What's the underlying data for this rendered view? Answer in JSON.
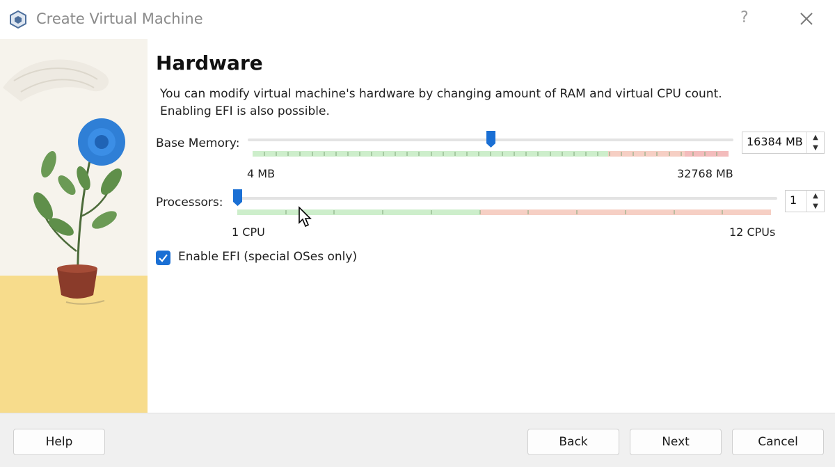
{
  "window": {
    "title": "Create Virtual Machine",
    "help_label": "?"
  },
  "page": {
    "title": "Hardware",
    "description_line1": "You can modify virtual machine's hardware by changing amount of RAM and virtual CPU count.",
    "description_line2": "Enabling EFI is also possible."
  },
  "memory": {
    "label": "Base Memory:",
    "min_label": "4 MB",
    "max_label": "32768 MB",
    "value_text": "16384 MB",
    "value": 16384,
    "min": 4,
    "max": 32768
  },
  "processors": {
    "label": "Processors:",
    "min_label": "1 CPU",
    "max_label": "12 CPUs",
    "value_text": "1",
    "value": 1,
    "min": 1,
    "max": 12
  },
  "efi": {
    "label": "Enable EFI (special OSes only)",
    "checked": true
  },
  "footer": {
    "help": "Help",
    "back": "Back",
    "next": "Next",
    "cancel": "Cancel"
  },
  "colors": {
    "accent": "#1a6fd4",
    "safe_zone": "#cdeecb",
    "warn_zone": "#f6cfc4",
    "danger_zone": "#f3bcbc"
  }
}
